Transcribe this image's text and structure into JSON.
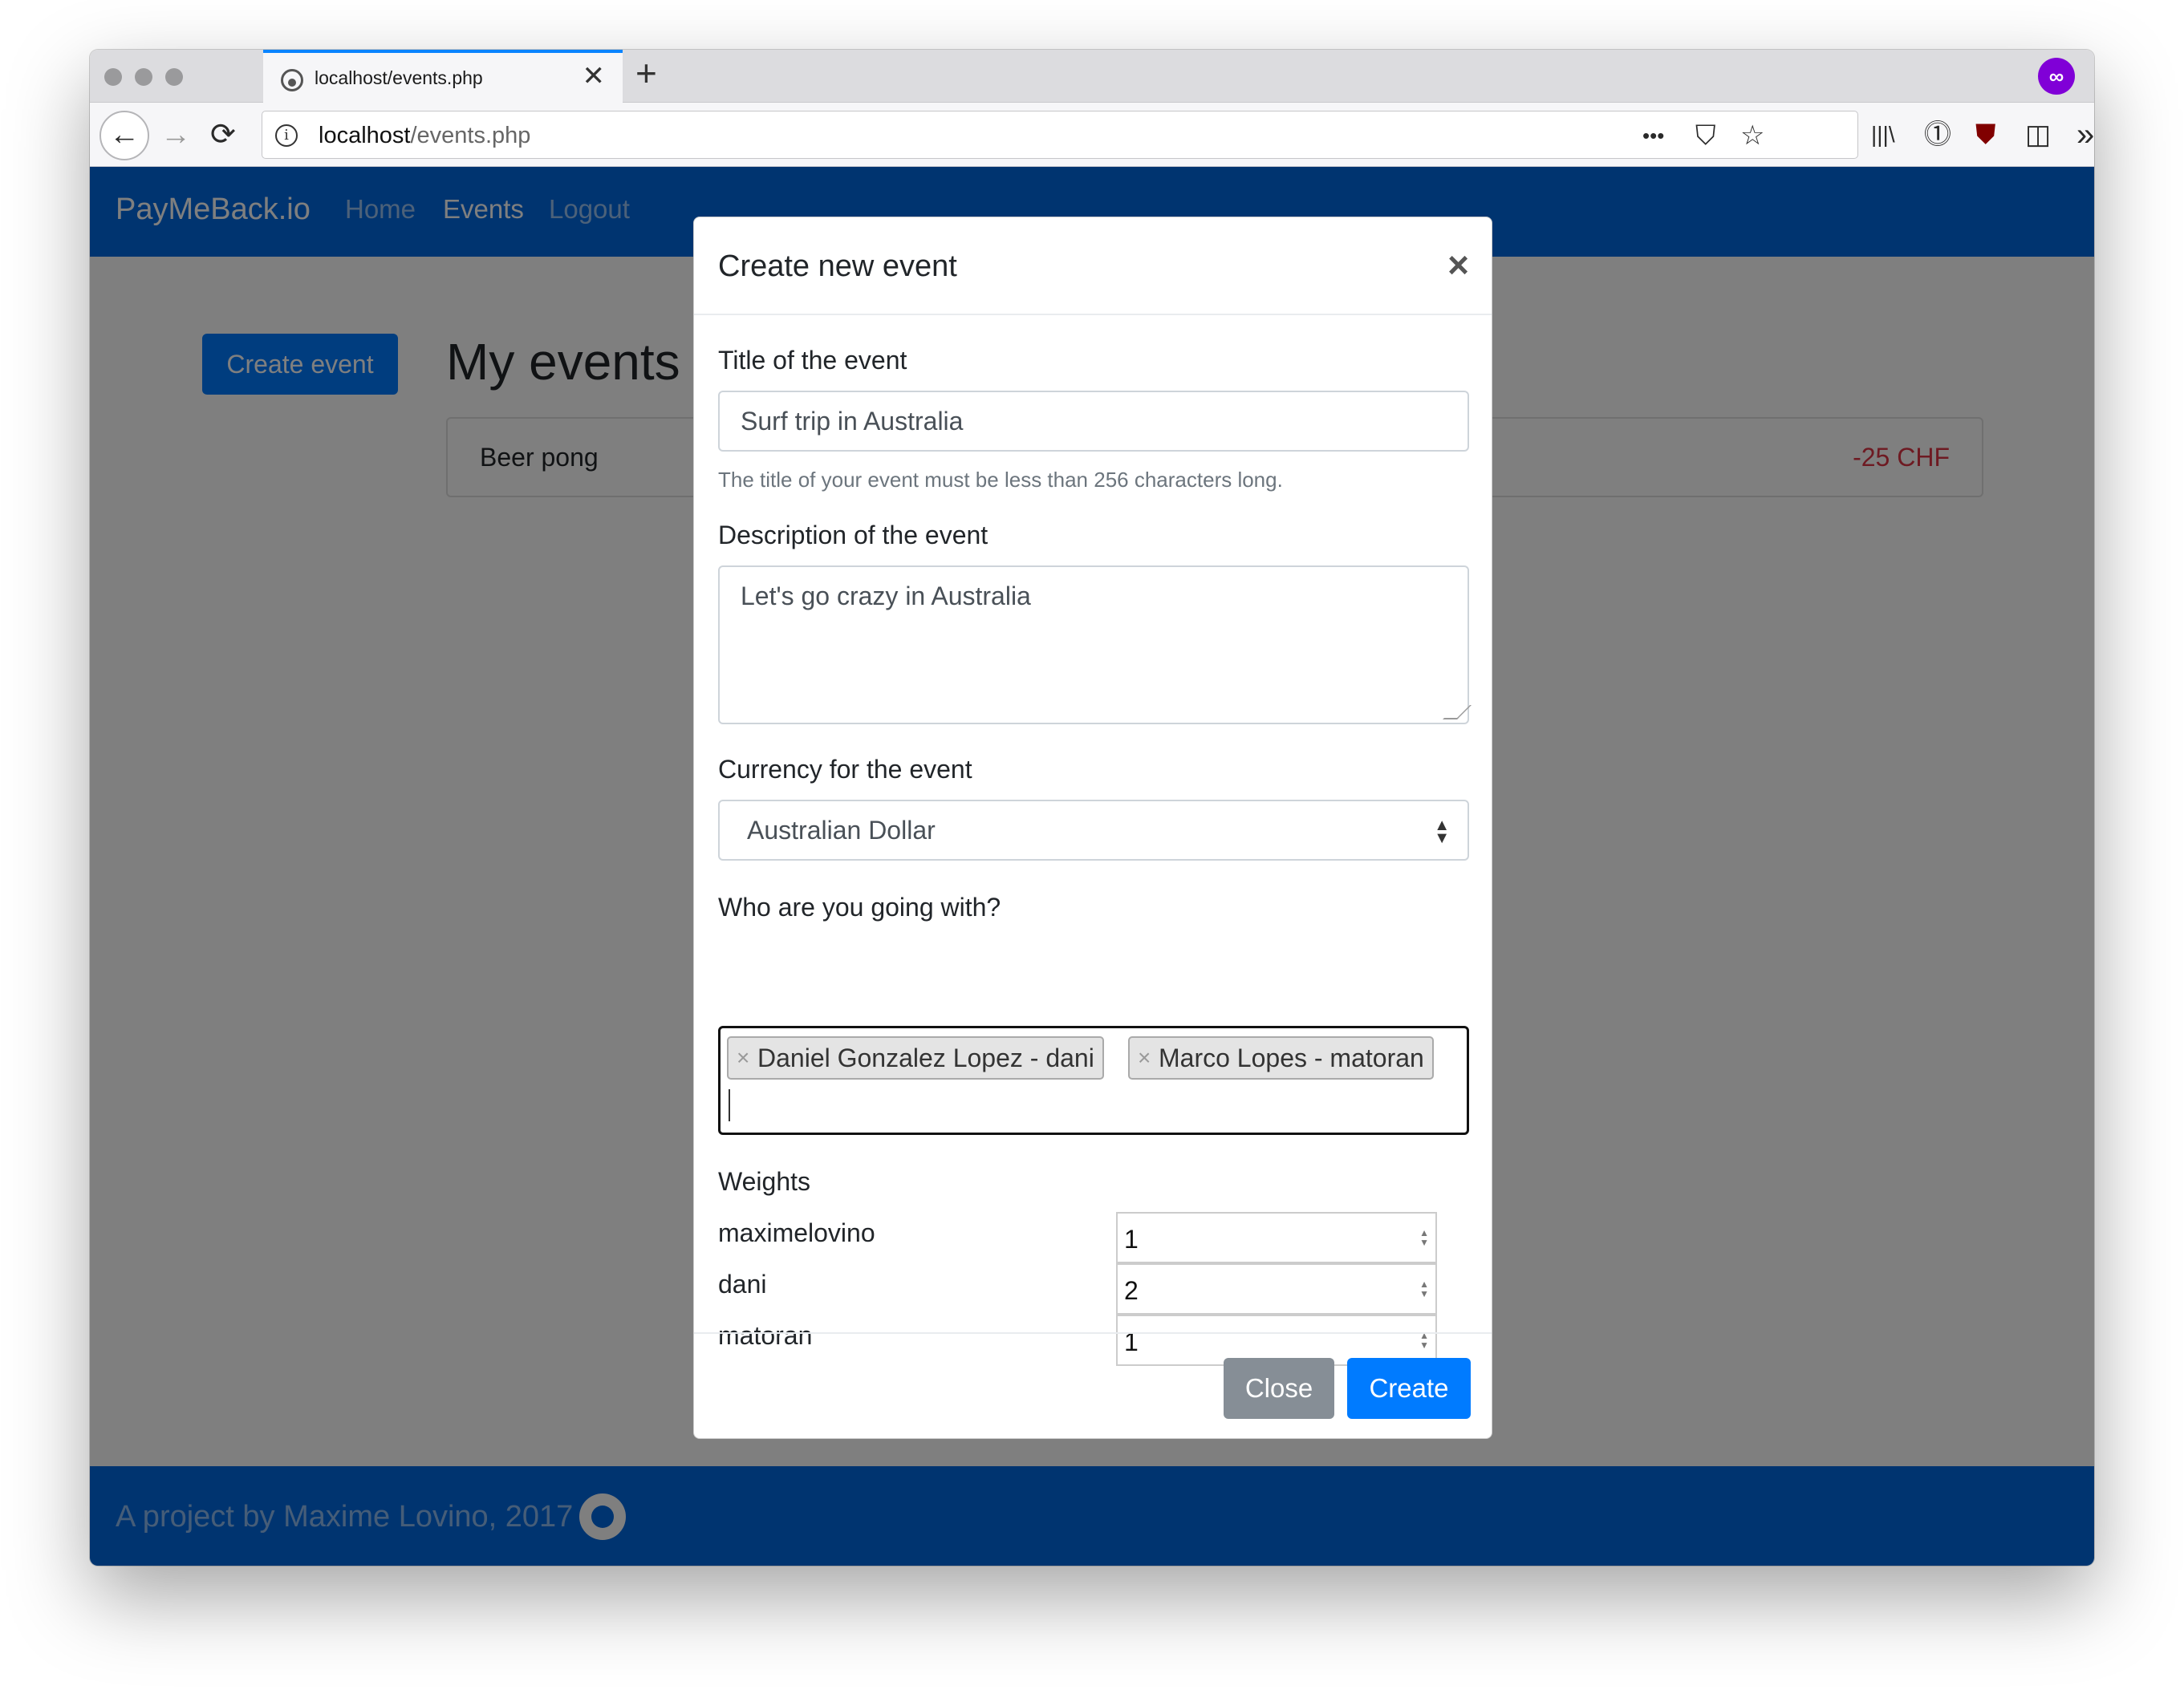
{
  "browser": {
    "tab_title": "localhost/events.php",
    "tab_close": "✕",
    "new_tab": "+",
    "url_host": "localhost",
    "url_path": "/events.php",
    "info_glyph": "i",
    "back_glyph": "←",
    "forward_glyph": "→",
    "reload_glyph": "⟳",
    "more_glyph": "•••",
    "pocket_glyph": "⛉",
    "star_glyph": "☆",
    "library_glyph": "|||\\",
    "onepassword_glyph": "⓵",
    "ublock_glyph": "⛊",
    "sidebar_glyph": "◫",
    "overflow_glyph": "»",
    "menu_glyph": "☰",
    "private_glyph": "∞"
  },
  "site": {
    "brand": "PayMeBack.io",
    "nav": [
      "Home",
      "Events",
      "Logout"
    ],
    "active_nav": "Events",
    "create_button": "Create event",
    "page_title": "My events",
    "events": [
      {
        "name": "Beer pong",
        "balance": "-25 CHF"
      }
    ],
    "footer": "A project by Maxime Lovino, 2017"
  },
  "modal": {
    "title": "Create new event",
    "close_glyph": "×",
    "title_label": "Title of the event",
    "title_value": "Surf trip in Australia",
    "title_help": "The title of your event must be less than 256 characters long.",
    "description_label": "Description of the event",
    "description_value": "Let's go crazy in Australia",
    "currency_label": "Currency for the event",
    "currency_value": "Australian Dollar",
    "participants_label": "Who are you going with?",
    "participants": [
      "Daniel Gonzalez Lopez - dani",
      "Marco Lopes - matoran"
    ],
    "tag_remove_glyph": "×",
    "weights_label": "Weights",
    "weights": [
      {
        "user": "maximelovino",
        "value": "1"
      },
      {
        "user": "dani",
        "value": "2"
      },
      {
        "user": "matoran",
        "value": "1"
      }
    ],
    "close_button": "Close",
    "create_button": "Create"
  },
  "colors": {
    "primary": "#007bff",
    "navbar": "#0069e0",
    "danger": "#dc3545",
    "secondary": "#868e96",
    "private_browsing": "#8000d7"
  }
}
